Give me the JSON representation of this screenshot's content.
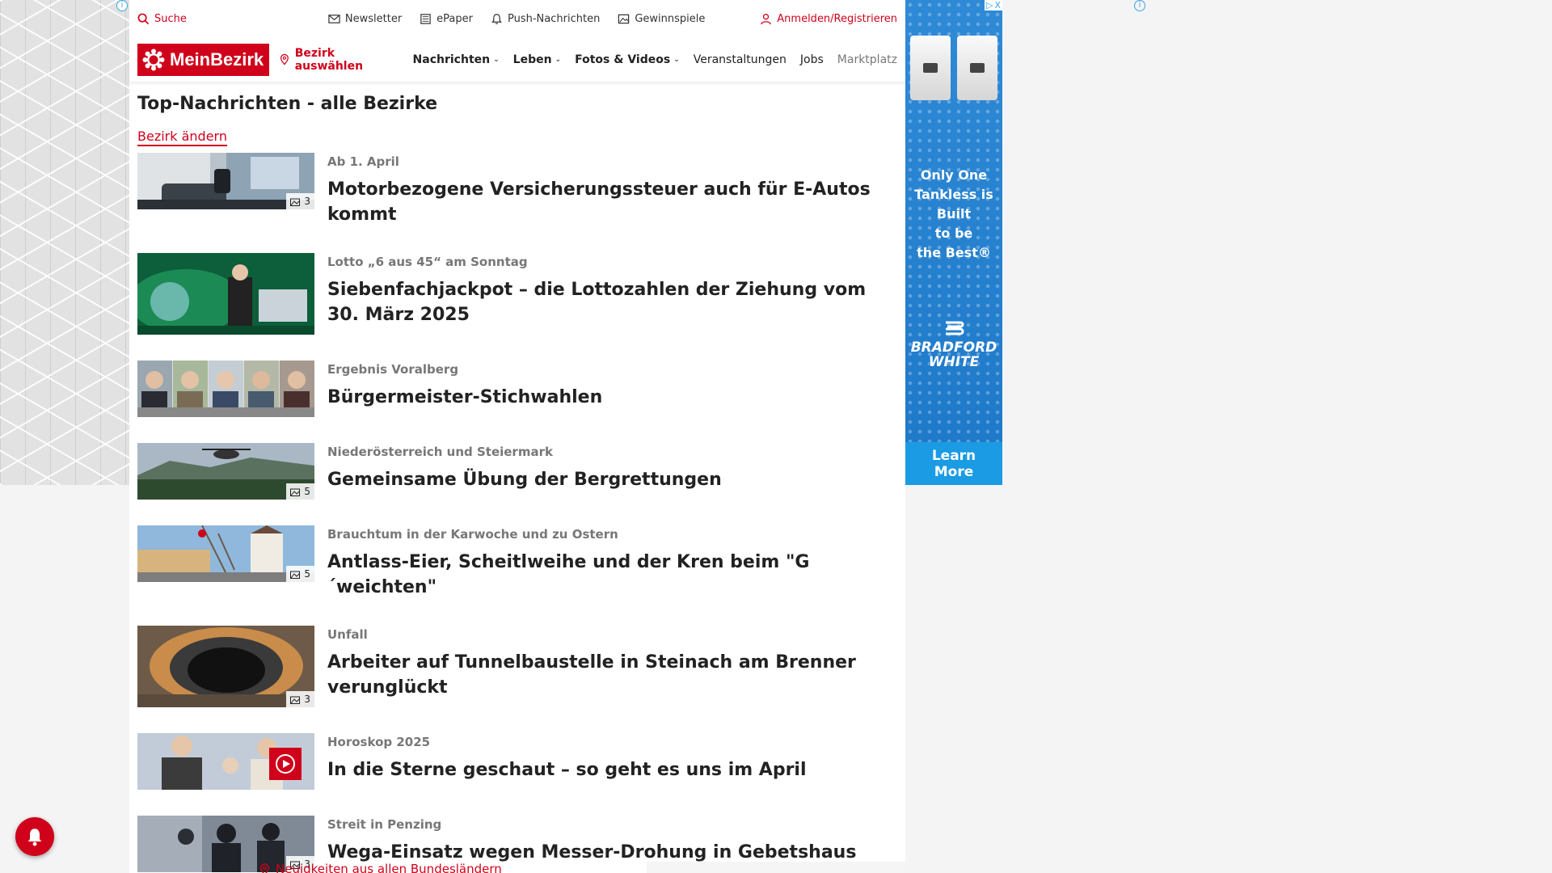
{
  "topbar": {
    "search": "Suche",
    "newsletter": "Newsletter",
    "epaper": "ePaper",
    "push": "Push-Nachrichten",
    "contests": "Gewinnspiele",
    "login": "Anmelden/Registrieren"
  },
  "nav": {
    "logo": "MeinBezirk",
    "bezirk": "Bezirk auswählen",
    "items": [
      "Nachrichten",
      "Leben",
      "Fotos & Videos",
      "Veranstaltungen",
      "Jobs",
      "Marktplatz"
    ]
  },
  "main": {
    "title": "Top-Nachrichten - alle Bezirke",
    "change_link": "Bezirk ändern",
    "articles": [
      {
        "kicker": "Ab 1. April",
        "headline": "Motorbezogene Versicherungssteuer auch für E-Autos kommt",
        "count": "3"
      },
      {
        "kicker": "Lotto „6 aus 45“ am Sonntag",
        "headline": "Siebenfachjackpot – die Lottozahlen der Ziehung vom 30. März 2025",
        "count": ""
      },
      {
        "kicker": "Ergebnis Voralberg",
        "headline": "Bürgermeister-Stichwahlen",
        "count": ""
      },
      {
        "kicker": "Niederösterreich und Steiermark",
        "headline": "Gemeinsame Übung der Bergrettungen",
        "count": "5"
      },
      {
        "kicker": "Brauchtum in der Karwoche und zu Ostern",
        "headline": "Antlass-Eier, Scheitlweihe und der Kren beim \"G´weichten\"",
        "count": "5"
      },
      {
        "kicker": "Unfall",
        "headline": "Arbeiter auf Tunnelbaustelle in Steinach am Brenner verunglückt",
        "count": "3"
      },
      {
        "kicker": "Horoskop 2025",
        "headline": "In die Sterne geschaut – so geht es uns im April",
        "count": ""
      },
      {
        "kicker": "Streit in Penzing",
        "headline": "Wega-Einsatz wegen Messer-Drohung in Gebetshaus",
        "count": "3"
      }
    ],
    "footer_link": "Neuigkeiten aus allen Bundesländern"
  },
  "ad": {
    "text_lines": [
      "Only One",
      "Tankless is",
      "Built",
      "to be",
      "the Best®"
    ],
    "brand_lines": [
      "BRADFORD",
      "WHITE"
    ],
    "cta_lines": [
      "Learn",
      "More"
    ],
    "info": "i",
    "adchoices": "▷",
    "close": "X"
  },
  "colors": {
    "brand": "#d0021b",
    "ad_blue": "#2f8ad6"
  }
}
